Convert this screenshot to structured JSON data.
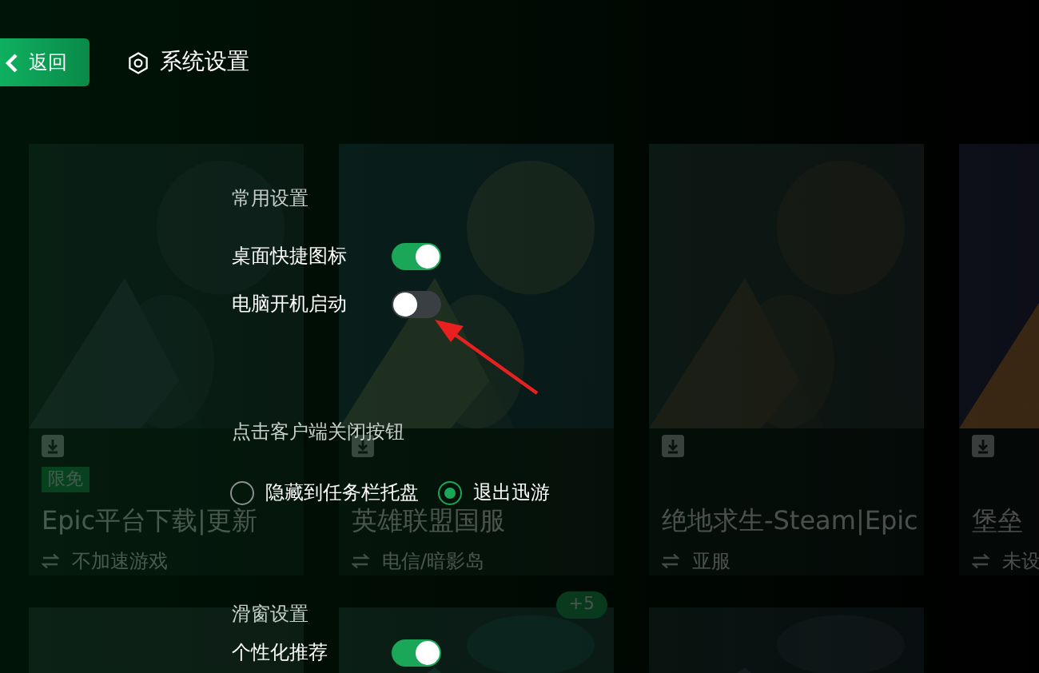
{
  "header": {
    "back_button": "返回",
    "title": "系统设置"
  },
  "games": [
    {
      "title": "Epic平台下载|更新",
      "subtitle": "不加速游戏",
      "badge": "限免"
    },
    {
      "title": "英雄联盟国服",
      "subtitle": "电信/暗影岛"
    },
    {
      "title": "绝地求生-Steam|Epic",
      "subtitle": "亚服"
    },
    {
      "title": "堡垒",
      "subtitle": "未设"
    }
  ],
  "lower_cards": [
    {
      "kind": "blank"
    },
    {
      "kind": "picture",
      "badge": "+5"
    },
    {
      "kind": "picture"
    }
  ],
  "settings": {
    "general_heading": "常用设置",
    "toggles": [
      {
        "label": "桌面快捷图标",
        "on": true
      },
      {
        "label": "电脑开机启动",
        "on": false
      }
    ],
    "close_heading": "点击客户端关闭按钮",
    "close_options": [
      {
        "label": "隐藏到任务栏托盘",
        "selected": false
      },
      {
        "label": "退出迅游",
        "selected": true
      }
    ],
    "slide_heading": "滑窗设置",
    "slide_toggles": [
      {
        "label": "个性化推荐",
        "on": true
      }
    ]
  }
}
